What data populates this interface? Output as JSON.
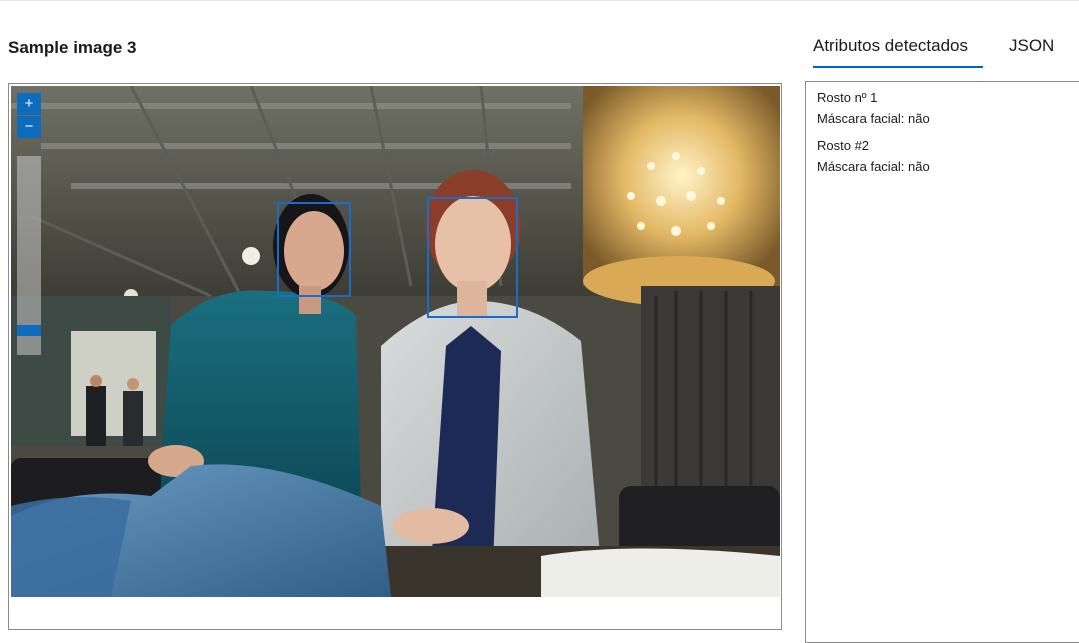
{
  "image_title": "Sample image 3",
  "tabs": [
    {
      "label": "Atributos detectados",
      "selected": true
    },
    {
      "label": "JSON",
      "selected": false
    }
  ],
  "zoom": {
    "in_label": "+",
    "out_label": "−",
    "level": 0.45
  },
  "results": [
    {
      "face_label": "Rosto nº 1",
      "mask_text": "Máscara facial: não"
    },
    {
      "face_label": "Rosto #2",
      "mask_text": "Máscara facial: não"
    }
  ],
  "colors": {
    "accent": "#0067b8",
    "face_box": "#1a6cc9",
    "zoom_button": "#0f6cbd"
  }
}
